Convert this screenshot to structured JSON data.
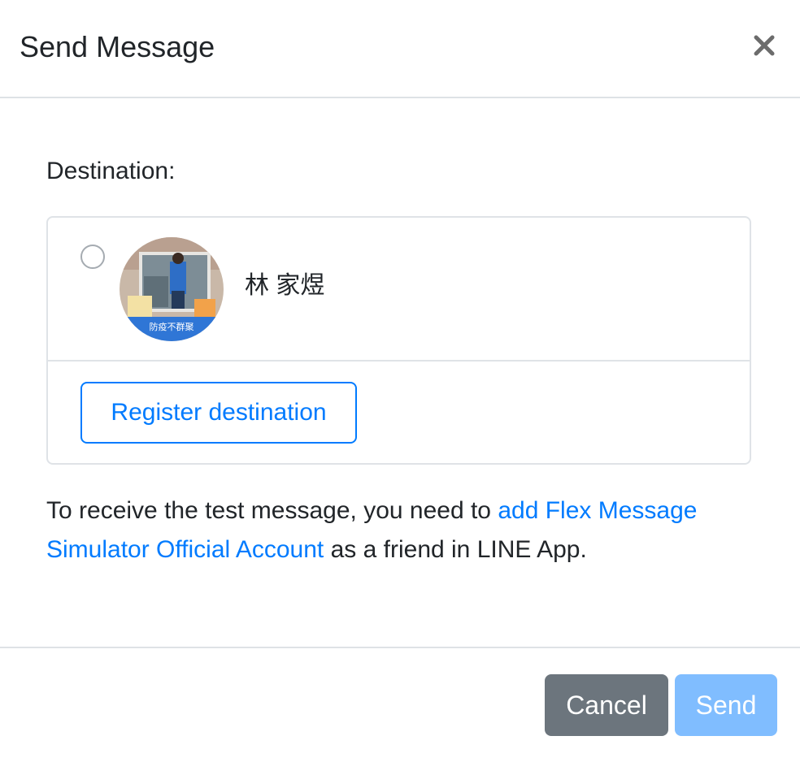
{
  "modal": {
    "title": "Send Message",
    "close_icon": "close-icon"
  },
  "destination": {
    "label": "Destination:",
    "items": [
      {
        "name": "林 家煜",
        "avatar_icon": "user-avatar",
        "avatar_caption": "防疫不群聚",
        "selected": false
      }
    ],
    "register_label": "Register destination"
  },
  "info": {
    "prefix": "To receive the test message, you need to ",
    "link_text": "add Flex Message Simulator Official Account",
    "suffix": " as a friend in LINE App."
  },
  "footer": {
    "cancel_label": "Cancel",
    "send_label": "Send"
  },
  "colors": {
    "primary": "#007bff",
    "secondary": "#6c757d",
    "send_disabled": "#80bdff"
  }
}
